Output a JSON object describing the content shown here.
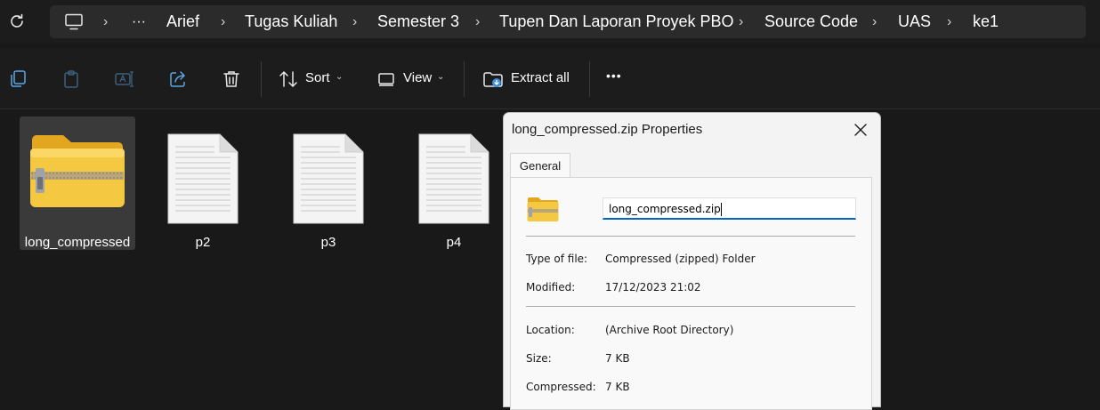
{
  "addressbar": {
    "more": "···",
    "breadcrumbs": [
      "Arief",
      "Tugas Kuliah",
      "Semester 3",
      "Tupen Dan Laporan Proyek PBO",
      "Source Code",
      "UAS",
      "ke1"
    ],
    "separator": "›"
  },
  "toolbar": {
    "sort_label": "Sort",
    "view_label": "View",
    "extract_label": "Extract all",
    "more_label": "•••",
    "chevron": "⌄"
  },
  "files": [
    {
      "name": "long_compressed",
      "icon": "zip-folder-icon",
      "selected": true
    },
    {
      "name": "p2",
      "icon": "document-icon"
    },
    {
      "name": "p3",
      "icon": "document-icon"
    },
    {
      "name": "p4",
      "icon": "document-icon"
    }
  ],
  "dialog": {
    "title": "long_compressed.zip Properties",
    "tab": "General",
    "filename": "long_compressed.zip",
    "type_label": "Type of file:",
    "type_value": "Compressed (zipped) Folder",
    "modified_label": "Modified:",
    "modified_value": "17/12/2023 21:02",
    "location_label": "Location:",
    "location_value": "(Archive Root Directory)",
    "size_label": "Size:",
    "size_value": "7 KB",
    "compressed_label": "Compressed:",
    "compressed_value": "7 KB"
  },
  "colors": {
    "background": "#191919",
    "folder_yellow": "#f5c842",
    "accent": "#0067c0"
  }
}
